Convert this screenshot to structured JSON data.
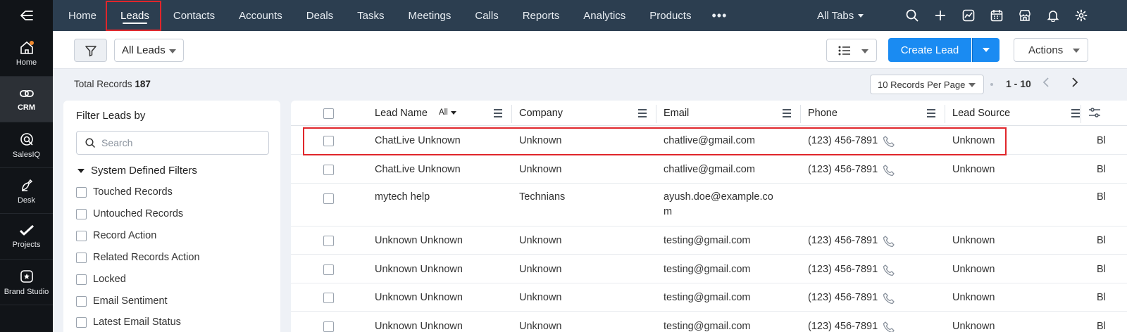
{
  "rail": {
    "items": [
      {
        "label": "Home"
      },
      {
        "label": "CRM",
        "active": true
      },
      {
        "label": "SalesIQ"
      },
      {
        "label": "Desk"
      },
      {
        "label": "Projects"
      },
      {
        "label": "Brand Studio"
      }
    ]
  },
  "topnav": {
    "tabs": [
      {
        "label": "Home"
      },
      {
        "label": "Leads",
        "active": true
      },
      {
        "label": "Contacts"
      },
      {
        "label": "Accounts"
      },
      {
        "label": "Deals"
      },
      {
        "label": "Tasks"
      },
      {
        "label": "Meetings"
      },
      {
        "label": "Calls"
      },
      {
        "label": "Reports"
      },
      {
        "label": "Analytics"
      },
      {
        "label": "Products"
      }
    ],
    "more": "•••",
    "all_tabs": "All Tabs",
    "icons": [
      "search-icon",
      "plus-icon",
      "activity-icon",
      "calendar-icon",
      "marketplace-icon",
      "bell-icon",
      "gear-icon"
    ]
  },
  "toolbar": {
    "view": "All Leads",
    "create": "Create Lead",
    "actions": "Actions"
  },
  "records": {
    "total_label": "Total Records",
    "total_count": "187",
    "per_page": "10 Records Per Page",
    "range": "1 - 10"
  },
  "filters": {
    "title": "Filter Leads by",
    "search_placeholder": "Search",
    "section": "System Defined Filters",
    "items": [
      "Touched Records",
      "Untouched Records",
      "Record Action",
      "Related Records Action",
      "Locked",
      "Email Sentiment",
      "Latest Email Status"
    ]
  },
  "table": {
    "columns": {
      "lead_name": "Lead Name",
      "all": "All",
      "company": "Company",
      "email": "Email",
      "phone": "Phone",
      "lead_source": "Lead Source"
    },
    "rows": [
      {
        "name": "ChatLive Unknown",
        "company": "Unknown",
        "email": "chatlive@gmail.com",
        "phone": "(123) 456-7891",
        "source": "Unknown",
        "extra": "Bl"
      },
      {
        "name": "ChatLive Unknown",
        "company": "Unknown",
        "email": "chatlive@gmail.com",
        "phone": "(123) 456-7891",
        "source": "Unknown",
        "extra": "Bl"
      },
      {
        "name": "mytech help",
        "company": "Technians",
        "email_line1": "ayush.doe@example.co",
        "email_line2": "m",
        "phone": "",
        "source": "",
        "extra": "Bl"
      },
      {
        "name": "Unknown Unknown",
        "company": "Unknown",
        "email": "testing@gmail.com",
        "phone": "(123) 456-7891",
        "source": "Unknown",
        "extra": "Bl"
      },
      {
        "name": "Unknown Unknown",
        "company": "Unknown",
        "email": "testing@gmail.com",
        "phone": "(123) 456-7891",
        "source": "Unknown",
        "extra": "Bl"
      },
      {
        "name": "Unknown Unknown",
        "company": "Unknown",
        "email": "testing@gmail.com",
        "phone": "(123) 456-7891",
        "source": "Unknown",
        "extra": "Bl"
      },
      {
        "name": "Unknown Unknown",
        "company": "Unknown",
        "email": "testing@gmail.com",
        "phone": "(123) 456-7891",
        "source": "Unknown",
        "extra": "Bl"
      }
    ]
  },
  "colors": {
    "nav_bg": "#2c3e50",
    "rail_bg": "#111418",
    "primary": "#1a8bf2",
    "highlight": "#e0262b"
  }
}
